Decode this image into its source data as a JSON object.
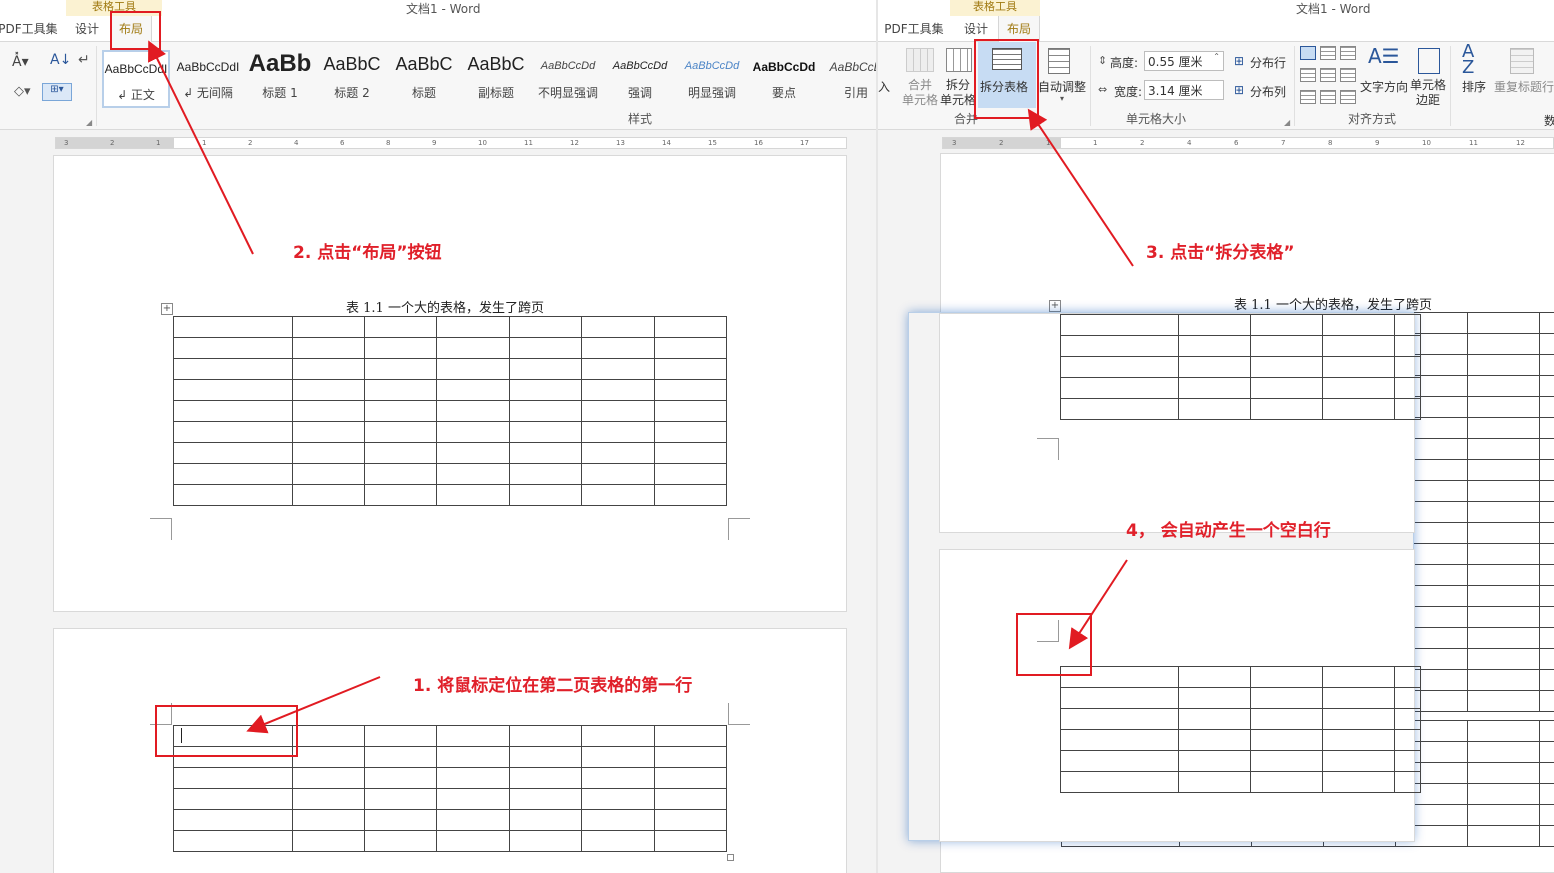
{
  "left": {
    "window_title": "文档1 - Word",
    "context_tab": "表格工具",
    "tabs": [
      "PDF工具集",
      "设计",
      "布局"
    ],
    "style_gallery": [
      {
        "preview": "AaBbCcDdI",
        "name": "↲ 正文"
      },
      {
        "preview": "AaBbCcDdI",
        "name": "↲ 无间隔"
      },
      {
        "preview": "AaBb",
        "name": "标题 1"
      },
      {
        "preview": "AaBbC",
        "name": "标题 2"
      },
      {
        "preview": "AaBbC",
        "name": "标题"
      },
      {
        "preview": "AaBbC",
        "name": "副标题"
      },
      {
        "preview": "AaBbCcDd",
        "name": "不明显强调"
      },
      {
        "preview": "AaBbCcDd",
        "name": "强调"
      },
      {
        "preview": "AaBbCcDd",
        "name": "明显强调"
      },
      {
        "preview": "AaBbCcDd",
        "name": "要点"
      },
      {
        "preview": "AaBbCcD",
        "name": "引用"
      }
    ],
    "styles_group_label": "样式",
    "ruler_numbers": [
      "3",
      "2",
      "1",
      "1",
      "2",
      "4",
      "6",
      "8",
      "9",
      "10",
      "11",
      "12",
      "13",
      "14",
      "15",
      "16",
      "17"
    ],
    "caption": "表 1.1  一个大的表格，发生了跨页"
  },
  "right": {
    "window_title": "文档1 - Word",
    "context_tab": "表格工具",
    "tabs": [
      "PDF工具集",
      "设计",
      "布局"
    ],
    "insert_partial": "入",
    "merge_cells": "合并\n单元格",
    "split_cells": "拆分\n单元格",
    "split_table": "拆分表格",
    "autofit": "自动调整",
    "merge_group": "合并",
    "height_label": "高度:",
    "height_value": "0.55 厘米",
    "width_label": "宽度:",
    "width_value": "3.14 厘米",
    "distribute_rows": "分布行",
    "distribute_cols": "分布列",
    "cell_size_group": "单元格大小",
    "text_direction": "文字方向",
    "cell_margins": "单元格\n边距",
    "align_group": "对齐方式",
    "sort": "排序",
    "repeat_header": "重复标题行",
    "data_partial": "数",
    "ruler_numbers": [
      "3",
      "2",
      "1",
      "1",
      "2",
      "4",
      "6",
      "7",
      "8",
      "9",
      "10",
      "11",
      "12"
    ],
    "caption": "表 1.1  一个大的表格，发生了跨页"
  },
  "annotations": {
    "step1": "1. 将鼠标定位在第二页表格的第一行",
    "step2": "2. 点击“布局”按钮",
    "step3": "3. 点击“拆分表格”",
    "step4": "4， 会自动产生一个空白行"
  },
  "colors": {
    "annotation": "#e11b22",
    "context_tab": "#a07a12",
    "highlight_btn": "#c7dcf3"
  }
}
